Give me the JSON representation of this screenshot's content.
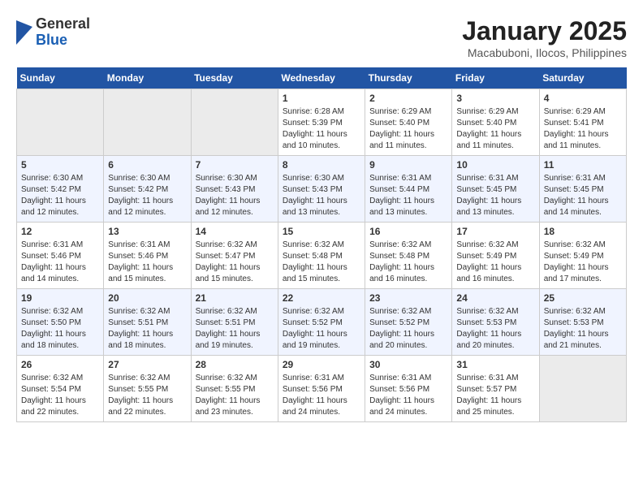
{
  "header": {
    "logo": {
      "general": "General",
      "blue": "Blue"
    },
    "title": "January 2025",
    "location": "Macabuboni, Ilocos, Philippines"
  },
  "weekdays": [
    "Sunday",
    "Monday",
    "Tuesday",
    "Wednesday",
    "Thursday",
    "Friday",
    "Saturday"
  ],
  "weeks": [
    [
      {
        "day": "",
        "empty": true
      },
      {
        "day": "",
        "empty": true
      },
      {
        "day": "",
        "empty": true
      },
      {
        "day": "1",
        "sunrise": "6:28 AM",
        "sunset": "5:39 PM",
        "daylight": "11 hours and 10 minutes."
      },
      {
        "day": "2",
        "sunrise": "6:29 AM",
        "sunset": "5:40 PM",
        "daylight": "11 hours and 11 minutes."
      },
      {
        "day": "3",
        "sunrise": "6:29 AM",
        "sunset": "5:40 PM",
        "daylight": "11 hours and 11 minutes."
      },
      {
        "day": "4",
        "sunrise": "6:29 AM",
        "sunset": "5:41 PM",
        "daylight": "11 hours and 11 minutes."
      }
    ],
    [
      {
        "day": "5",
        "sunrise": "6:30 AM",
        "sunset": "5:42 PM",
        "daylight": "11 hours and 12 minutes."
      },
      {
        "day": "6",
        "sunrise": "6:30 AM",
        "sunset": "5:42 PM",
        "daylight": "11 hours and 12 minutes."
      },
      {
        "day": "7",
        "sunrise": "6:30 AM",
        "sunset": "5:43 PM",
        "daylight": "11 hours and 12 minutes."
      },
      {
        "day": "8",
        "sunrise": "6:30 AM",
        "sunset": "5:43 PM",
        "daylight": "11 hours and 13 minutes."
      },
      {
        "day": "9",
        "sunrise": "6:31 AM",
        "sunset": "5:44 PM",
        "daylight": "11 hours and 13 minutes."
      },
      {
        "day": "10",
        "sunrise": "6:31 AM",
        "sunset": "5:45 PM",
        "daylight": "11 hours and 13 minutes."
      },
      {
        "day": "11",
        "sunrise": "6:31 AM",
        "sunset": "5:45 PM",
        "daylight": "11 hours and 14 minutes."
      }
    ],
    [
      {
        "day": "12",
        "sunrise": "6:31 AM",
        "sunset": "5:46 PM",
        "daylight": "11 hours and 14 minutes."
      },
      {
        "day": "13",
        "sunrise": "6:31 AM",
        "sunset": "5:46 PM",
        "daylight": "11 hours and 15 minutes."
      },
      {
        "day": "14",
        "sunrise": "6:32 AM",
        "sunset": "5:47 PM",
        "daylight": "11 hours and 15 minutes."
      },
      {
        "day": "15",
        "sunrise": "6:32 AM",
        "sunset": "5:48 PM",
        "daylight": "11 hours and 15 minutes."
      },
      {
        "day": "16",
        "sunrise": "6:32 AM",
        "sunset": "5:48 PM",
        "daylight": "11 hours and 16 minutes."
      },
      {
        "day": "17",
        "sunrise": "6:32 AM",
        "sunset": "5:49 PM",
        "daylight": "11 hours and 16 minutes."
      },
      {
        "day": "18",
        "sunrise": "6:32 AM",
        "sunset": "5:49 PM",
        "daylight": "11 hours and 17 minutes."
      }
    ],
    [
      {
        "day": "19",
        "sunrise": "6:32 AM",
        "sunset": "5:50 PM",
        "daylight": "11 hours and 18 minutes."
      },
      {
        "day": "20",
        "sunrise": "6:32 AM",
        "sunset": "5:51 PM",
        "daylight": "11 hours and 18 minutes."
      },
      {
        "day": "21",
        "sunrise": "6:32 AM",
        "sunset": "5:51 PM",
        "daylight": "11 hours and 19 minutes."
      },
      {
        "day": "22",
        "sunrise": "6:32 AM",
        "sunset": "5:52 PM",
        "daylight": "11 hours and 19 minutes."
      },
      {
        "day": "23",
        "sunrise": "6:32 AM",
        "sunset": "5:52 PM",
        "daylight": "11 hours and 20 minutes."
      },
      {
        "day": "24",
        "sunrise": "6:32 AM",
        "sunset": "5:53 PM",
        "daylight": "11 hours and 20 minutes."
      },
      {
        "day": "25",
        "sunrise": "6:32 AM",
        "sunset": "5:53 PM",
        "daylight": "11 hours and 21 minutes."
      }
    ],
    [
      {
        "day": "26",
        "sunrise": "6:32 AM",
        "sunset": "5:54 PM",
        "daylight": "11 hours and 22 minutes."
      },
      {
        "day": "27",
        "sunrise": "6:32 AM",
        "sunset": "5:55 PM",
        "daylight": "11 hours and 22 minutes."
      },
      {
        "day": "28",
        "sunrise": "6:32 AM",
        "sunset": "5:55 PM",
        "daylight": "11 hours and 23 minutes."
      },
      {
        "day": "29",
        "sunrise": "6:31 AM",
        "sunset": "5:56 PM",
        "daylight": "11 hours and 24 minutes."
      },
      {
        "day": "30",
        "sunrise": "6:31 AM",
        "sunset": "5:56 PM",
        "daylight": "11 hours and 24 minutes."
      },
      {
        "day": "31",
        "sunrise": "6:31 AM",
        "sunset": "5:57 PM",
        "daylight": "11 hours and 25 minutes."
      },
      {
        "day": "",
        "empty": true
      }
    ]
  ]
}
